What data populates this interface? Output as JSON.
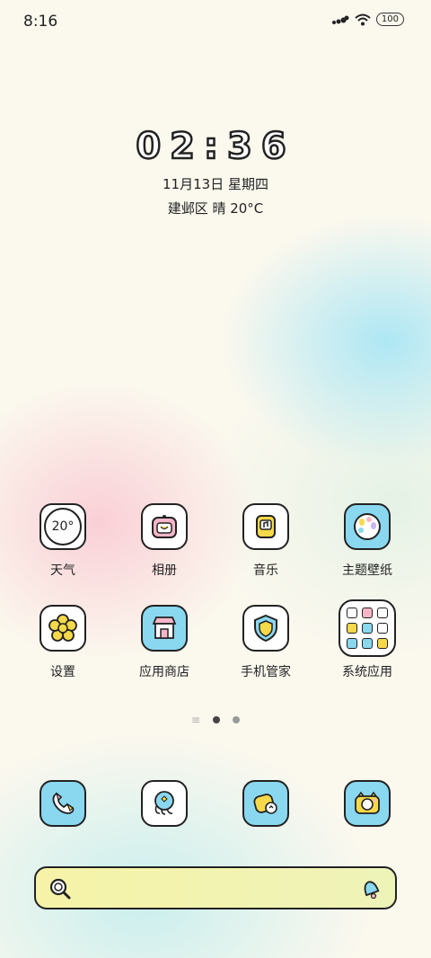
{
  "status": {
    "time": "8:16",
    "battery": "100"
  },
  "clock": {
    "time": "02:36",
    "date": "11月13日 星期四",
    "weather": "建邺区 晴 20°C"
  },
  "apps": [
    {
      "label": "天气",
      "icon": "weather-icon",
      "icon_text": "20°"
    },
    {
      "label": "相册",
      "icon": "gallery-icon"
    },
    {
      "label": "音乐",
      "icon": "music-icon"
    },
    {
      "label": "主题壁纸",
      "icon": "themes-icon"
    },
    {
      "label": "设置",
      "icon": "settings-icon"
    },
    {
      "label": "应用商店",
      "icon": "app-store-icon"
    },
    {
      "label": "手机管家",
      "icon": "security-icon"
    },
    {
      "label": "系统应用",
      "icon": "system-apps-folder-icon"
    }
  ],
  "dock": [
    {
      "icon": "phone-icon"
    },
    {
      "icon": "messages-icon"
    },
    {
      "icon": "browser-icon"
    },
    {
      "icon": "camera-icon"
    }
  ],
  "colors": {
    "icon_blue": "#8ad8f0",
    "outline": "#222222",
    "yellow": "#f6d94a",
    "pink": "#f7b6c8"
  }
}
